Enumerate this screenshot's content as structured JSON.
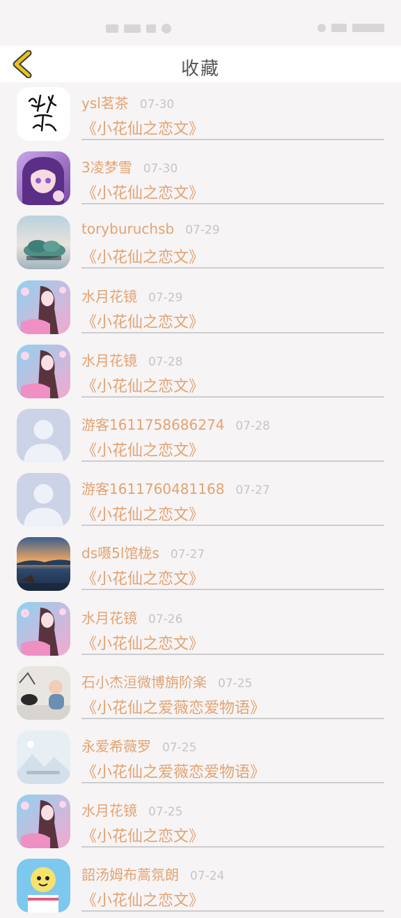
{
  "status_bar": {},
  "header": {
    "title": "收藏",
    "back_icon": "chevron-left-icon",
    "back_color": "#e8c21f"
  },
  "colors": {
    "accent": "#e3a371",
    "date": "#c6c6c6",
    "title": "#555555",
    "background": "#f6f4f5"
  },
  "items": [
    {
      "name": "ysl茗茶",
      "date": "07-30",
      "book": "《小花仙之恋文》",
      "avatar": "calligraphy-avatar"
    },
    {
      "name": "3凌梦雪",
      "date": "07-30",
      "book": "《小花仙之恋文》",
      "avatar": "anime-girl-avatar"
    },
    {
      "name": "toryburuchsb",
      "date": "07-29",
      "book": "《小花仙之恋文》",
      "avatar": "island-avatar"
    },
    {
      "name": "水月花镜",
      "date": "07-29",
      "book": "《小花仙之恋文》",
      "avatar": "sakura-girl-avatar"
    },
    {
      "name": "水月花镜",
      "date": "07-28",
      "book": "《小花仙之恋文》",
      "avatar": "sakura-girl-avatar"
    },
    {
      "name": "游客1611758686274",
      "date": "07-28",
      "book": "《小花仙之恋文》",
      "avatar": "default-user-avatar"
    },
    {
      "name": "游客1611760481168",
      "date": "07-27",
      "book": "《小花仙之恋文》",
      "avatar": "default-user-avatar"
    },
    {
      "name": "ds嗫5l馆栊s",
      "date": "07-27",
      "book": "《小花仙之恋文》",
      "avatar": "sunset-avatar"
    },
    {
      "name": "水月花镜",
      "date": "07-26",
      "book": "《小花仙之恋文》",
      "avatar": "sakura-girl-avatar"
    },
    {
      "name": "石小杰洹微博旃阶楽",
      "date": "07-25",
      "book": "《小花仙之爱薇恋爱物语》",
      "avatar": "baby-photo-avatar"
    },
    {
      "name": "永爱希薇罗",
      "date": "07-25",
      "book": "《小花仙之爱薇恋爱物语》",
      "avatar": "image-placeholder-avatar"
    },
    {
      "name": "水月花镜",
      "date": "07-25",
      "book": "《小花仙之恋文》",
      "avatar": "sakura-girl-avatar"
    },
    {
      "name": "韶汤姆布蒿氛朗",
      "date": "07-24",
      "book": "《小花仙之恋文》",
      "avatar": "cartoon-avatar"
    }
  ]
}
